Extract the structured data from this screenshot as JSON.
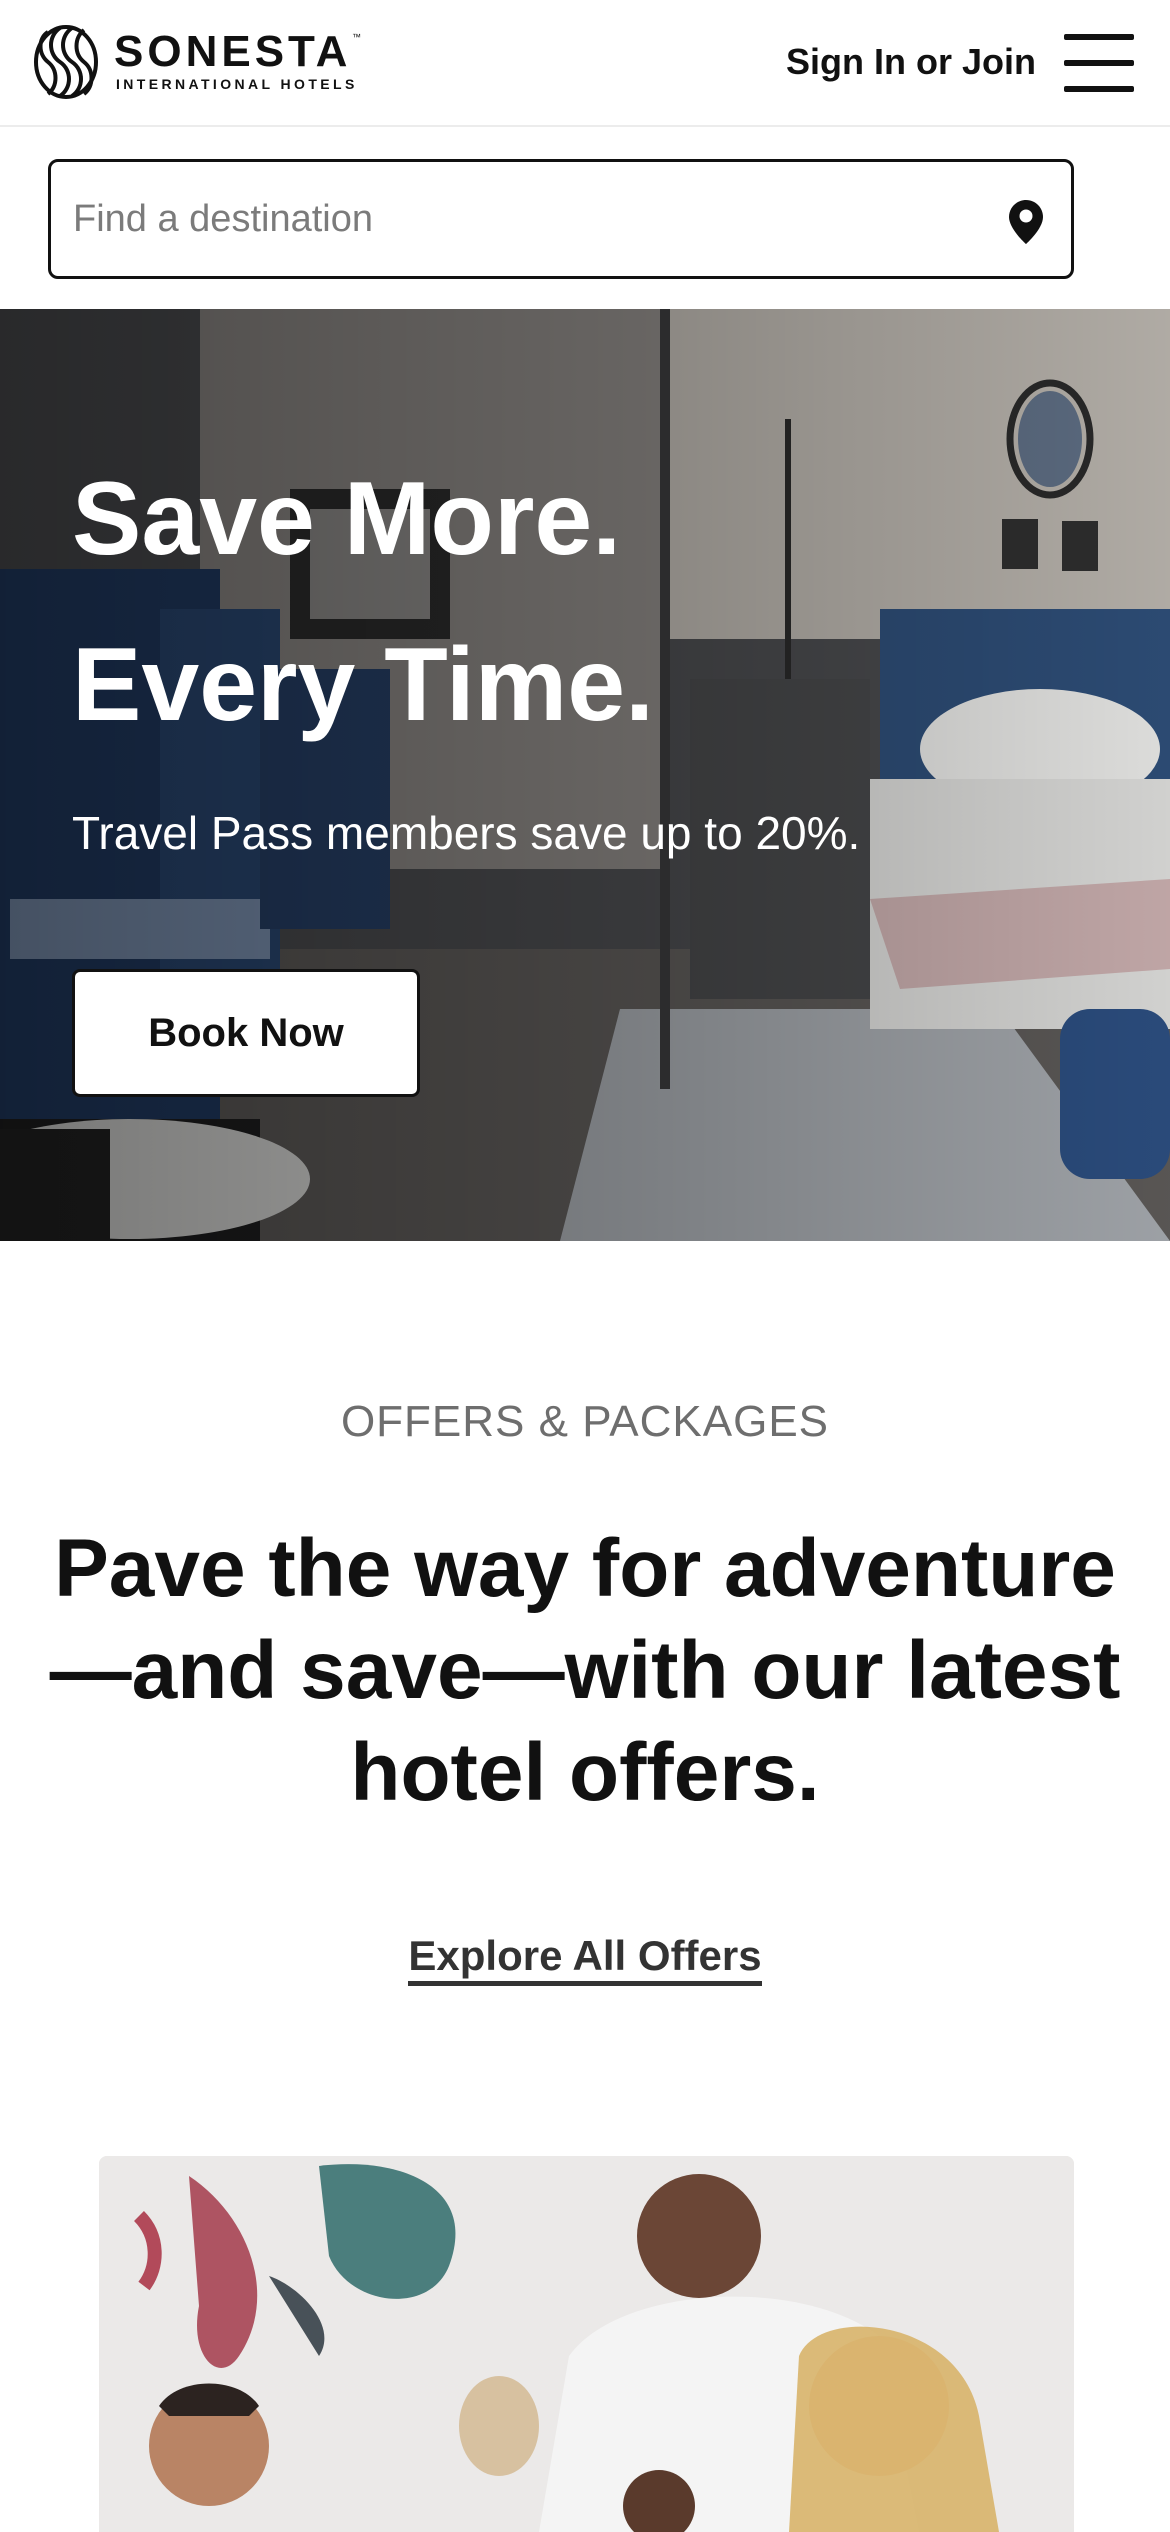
{
  "header": {
    "brand_name": "SONESTA",
    "brand_tagline": "INTERNATIONAL HOTELS",
    "brand_tm": "™",
    "signin_label": "Sign In or Join"
  },
  "search": {
    "placeholder": "Find a destination",
    "value": ""
  },
  "hero": {
    "title_line1": "Save More.",
    "title_line2": "Every Time.",
    "subtitle": "Travel Pass members save up to 20%.",
    "cta_label": "Book Now"
  },
  "offers": {
    "eyebrow": "OFFERS & PACKAGES",
    "headline": "Pave the way for adventure—and save—with our latest hotel offers.",
    "link_label": "Explore All Offers"
  },
  "icons": {
    "logo": "sonesta-logo-mark",
    "menu": "hamburger-menu-icon",
    "search": "map-pin-icon"
  }
}
